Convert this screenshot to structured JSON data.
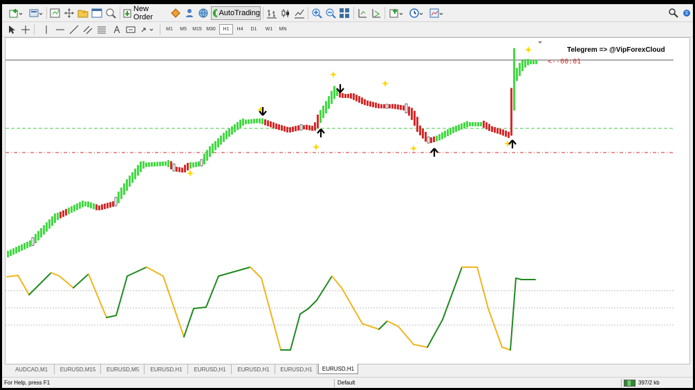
{
  "toolbar": {
    "new_order_label": "New Order",
    "auto_trading_label": "AutoTrading",
    "timeframes": [
      "M1",
      "M5",
      "M15",
      "M30",
      "H1",
      "H4",
      "D1",
      "W1",
      "MN"
    ],
    "active_timeframe": "H1"
  },
  "chart": {
    "telegram_text": "Telegrem => @VipForexCloud",
    "countdown_text": "<--00:01",
    "colors": {
      "bull": "#43d943",
      "bear": "#d42a2a",
      "signal_star": "#ffd800",
      "arrow": "#000000",
      "osc_up": "#1f8a1f",
      "osc_down": "#f2b51e",
      "support_line": "#49c449",
      "resistance_line": "#d42a2a"
    }
  },
  "tabs": [
    "AUDCAD,M1",
    "EURUSD,M15",
    "EURUSD,M5",
    "EURUSD,H1",
    "EURUSD,H1",
    "EURUSD,H1",
    "EURUSD,H1",
    "EURUSD,H1"
  ],
  "active_tab_index": 7,
  "status": {
    "help_text": "For Help, press F1",
    "profile": "Default",
    "traffic": "397/2 kb"
  }
}
